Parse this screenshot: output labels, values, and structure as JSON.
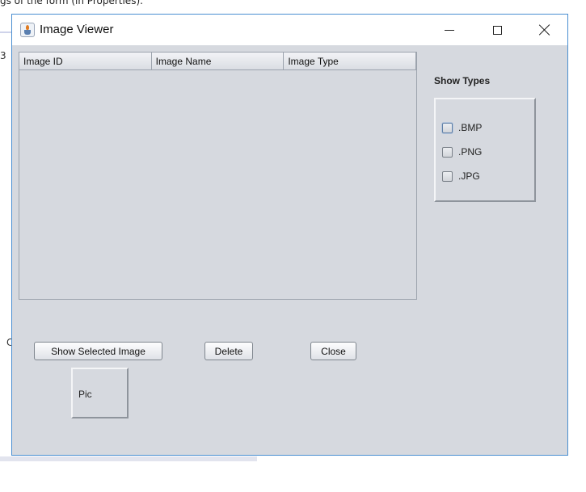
{
  "background": {
    "top_text": "gs of the form (in Properties).",
    "left_fragment_1": "3",
    "left_fragment_2": "C"
  },
  "window": {
    "title": "Image Viewer",
    "controls": [
      "minimize",
      "maximize",
      "close"
    ]
  },
  "table": {
    "columns": [
      "Image ID",
      "Image Name",
      "Image Type"
    ],
    "rows": []
  },
  "show_types": {
    "label": "Show Types",
    "options": [
      {
        "label": ".BMP",
        "checked": false
      },
      {
        "label": ".PNG",
        "checked": false
      },
      {
        "label": ".JPG",
        "checked": false
      }
    ]
  },
  "buttons": {
    "show_selected": "Show Selected Image",
    "delete": "Delete",
    "close": "Close"
  },
  "pic": {
    "label": "Pic"
  },
  "icons": {
    "app": "java-cup-icon",
    "minimize": "minimize-icon",
    "maximize": "maximize-icon",
    "close": "close-icon"
  }
}
